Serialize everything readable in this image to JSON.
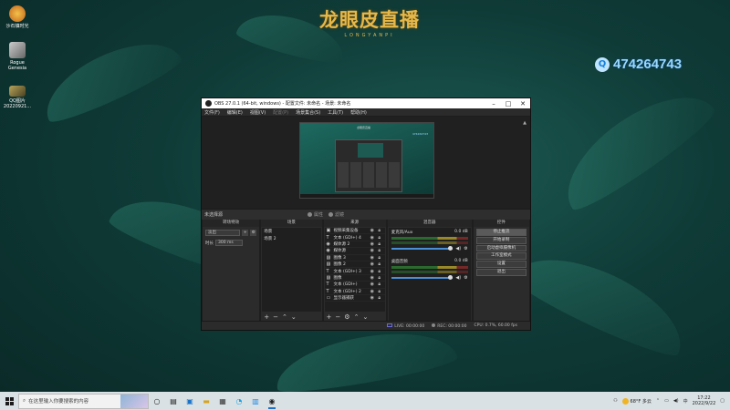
{
  "desktop": {
    "brand_title": "龙眼皮直播",
    "brand_sub": "LONGYANPI",
    "qq_number": "474264743",
    "icons": [
      {
        "label": "沙石镇时光"
      },
      {
        "label": "Rogue Genesia"
      },
      {
        "label": "QQ图片 20220921..."
      }
    ]
  },
  "obs": {
    "title": "OBS 27.0.1 (64-bit, windows) - 配置文件: 未命名 - 场景: 未命名",
    "menu": [
      "文件(F)",
      "编辑(E)",
      "视图(V)",
      "配置(P)",
      "场景集合(S)",
      "工具(T)",
      "帮助(H)"
    ],
    "menu_disabled_index": 3,
    "preview": {
      "text": "龙眼皮直播",
      "qq": "474264743"
    },
    "context_bar": {
      "label": "未选择源",
      "properties": "属性",
      "filters": "滤镜"
    },
    "docks": {
      "transitions": {
        "title": "转场特效",
        "effect": "淡出",
        "duration_label": "时长",
        "duration_value": "300 ms"
      },
      "scenes": {
        "title": "场景",
        "items": [
          "场景",
          "场景 2"
        ]
      },
      "sources": {
        "title": "来源",
        "items": [
          {
            "icon": "▣",
            "name": "视频采集设备"
          },
          {
            "icon": "T",
            "name": "文本 (GDI+) 4"
          },
          {
            "icon": "◉",
            "name": "媒体源 2"
          },
          {
            "icon": "◉",
            "name": "媒体源"
          },
          {
            "icon": "▨",
            "name": "图像 3"
          },
          {
            "icon": "▨",
            "name": "图像 2"
          },
          {
            "icon": "T",
            "name": "文本 (GDI+) 3"
          },
          {
            "icon": "▨",
            "name": "图像"
          },
          {
            "icon": "T",
            "name": "文本 (GDI+)"
          },
          {
            "icon": "T",
            "name": "文本 (GDI+) 2"
          },
          {
            "icon": "▭",
            "name": "显示器捕获"
          }
        ]
      },
      "mixer": {
        "title": "混音器",
        "channels": [
          {
            "name": "麦克风/Aux",
            "level": "0.0 dB"
          },
          {
            "name": "桌面音频",
            "level": "0.0 dB"
          }
        ]
      },
      "controls": {
        "title": "控件",
        "buttons": [
          "停止推流",
          "开始录制",
          "启动虚拟摄像机",
          "工作室模式",
          "设置",
          "退出"
        ],
        "active_index": 0
      }
    },
    "status": {
      "live": "LIVE: 00:00:00",
      "rec": "REC: 00:00:00",
      "cpu": "CPU: 0.7%, 60.00 fps"
    }
  },
  "taskbar": {
    "search_placeholder": "在这里输入你要搜索的内容",
    "weather": "68°F 多云",
    "ime": "中",
    "time": "17:22",
    "date": "2022/9/22"
  }
}
